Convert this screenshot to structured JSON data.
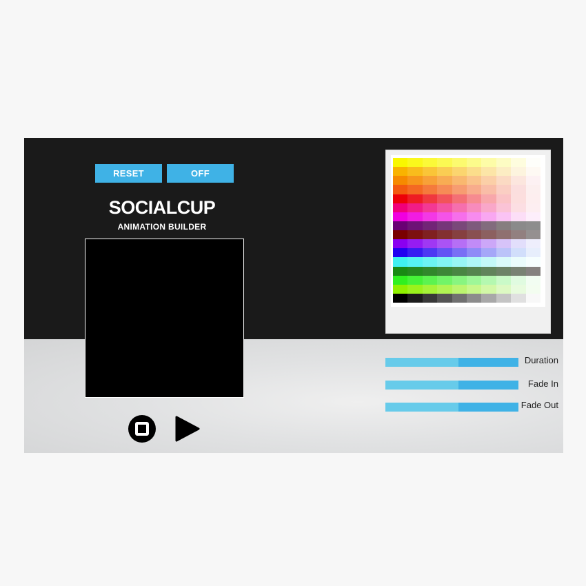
{
  "toolbar": {
    "reset_label": "RESET",
    "off_label": "OFF"
  },
  "header": {
    "title": "SOCIALCUP",
    "subtitle": "ANIMATION BUILDER"
  },
  "playback": {
    "stop_icon": "stop-icon",
    "play_icon": "play-icon"
  },
  "colors": {
    "accent": "#3fb2e6",
    "accent_light": "#67cbea",
    "panel_dark": "#1a1a1a",
    "canvas": "#000000"
  },
  "palette": {
    "rows": [
      [
        "#f9f700",
        "#faf81c",
        "#fbf938",
        "#fbf953",
        "#fcfa6f",
        "#fcfb8b",
        "#fdfca7",
        "#fdfcc3",
        "#fefdde",
        "#fefefa"
      ],
      [
        "#f9b300",
        "#f9bc1c",
        "#fac538",
        "#facd53",
        "#fbd56f",
        "#fbdd8b",
        "#fce5a7",
        "#fcedc3",
        "#fdf4de",
        "#fef9f3"
      ],
      [
        "#f68a00",
        "#f7961c",
        "#f8a138",
        "#f8ac53",
        "#f9b86f",
        "#fac38b",
        "#fbcfa7",
        "#fbdac3",
        "#fce6de",
        "#fdf1f3"
      ],
      [
        "#f3590f",
        "#f46923",
        "#f57a3c",
        "#f68b56",
        "#f79c71",
        "#f8ac8c",
        "#f9bda7",
        "#facec3",
        "#fbdede",
        "#fcefef"
      ],
      [
        "#ec0008",
        "#ee1c23",
        "#f0383f",
        "#f2535a",
        "#f46f75",
        "#f68b90",
        "#f8a7ab",
        "#fac3c6",
        "#fcdede",
        "#fdeeef"
      ],
      [
        "#f0007a",
        "#f11c87",
        "#f33894",
        "#f453a1",
        "#f66fae",
        "#f78bbc",
        "#f9a7c9",
        "#fac3d6",
        "#fcdee3",
        "#fdeef1"
      ],
      [
        "#f000e0",
        "#f11ce2",
        "#f338e5",
        "#f453e8",
        "#f66feb",
        "#f78bee",
        "#f9a7f1",
        "#fac3f4",
        "#fcdef7",
        "#fdeefb"
      ],
      [
        "#6a0074",
        "#6e1276",
        "#722477",
        "#763679",
        "#7a487a",
        "#7e5a7c",
        "#826c7d",
        "#867e7f",
        "#8a8a8a",
        "#8d8d8d"
      ],
      [
        "#7a0000",
        "#7d1010",
        "#802020",
        "#833030",
        "#864040",
        "#895050",
        "#8c6060",
        "#8f7070",
        "#928080",
        "#959090"
      ],
      [
        "#8a00f0",
        "#951cf2",
        "#a038f3",
        "#ab53f4",
        "#b66ff5",
        "#c18bf7",
        "#cca7f8",
        "#d7c3f9",
        "#e2defb",
        "#eeeefc"
      ],
      [
        "#2100f0",
        "#371cf2",
        "#4d38f3",
        "#6353f4",
        "#796ff5",
        "#8f8bf7",
        "#a5a7f8",
        "#bbc3f9",
        "#d1defb",
        "#e7eefc"
      ],
      [
        "#40f0f0",
        "#56f2f2",
        "#6cf3f3",
        "#82f4f4",
        "#98f5f5",
        "#aef7f7",
        "#c4f8f8",
        "#dafafa",
        "#ebfcfc",
        "#f6fefe"
      ],
      [
        "#198a13",
        "#25891f",
        "#31882b",
        "#3d8737",
        "#498643",
        "#55854f",
        "#61845b",
        "#6d8367",
        "#798273",
        "#85817f"
      ],
      [
        "#30f020",
        "#46f238",
        "#5cf350",
        "#72f468",
        "#88f580",
        "#9ef798",
        "#b4f8b0",
        "#cafac8",
        "#e0fbe0",
        "#f2fdf2"
      ],
      [
        "#90f000",
        "#9bf21c",
        "#a6f338",
        "#b1f453",
        "#bcf56f",
        "#c7f78b",
        "#d2f8a7",
        "#ddf9c3",
        "#e8fbde",
        "#f3fdf0"
      ],
      [
        "#000000",
        "#1c1c1c",
        "#383838",
        "#545454",
        "#707070",
        "#8c8c8c",
        "#a8a8a8",
        "#c4c4c4",
        "#e0e0e0",
        "#f8f8f8"
      ]
    ]
  },
  "sliders": {
    "duration": {
      "label": "Duration",
      "value": 0.55
    },
    "fade_in": {
      "label": "Fade In",
      "value": 0.55
    },
    "fade_out": {
      "label": "Fade Out",
      "value": 0.55
    }
  }
}
